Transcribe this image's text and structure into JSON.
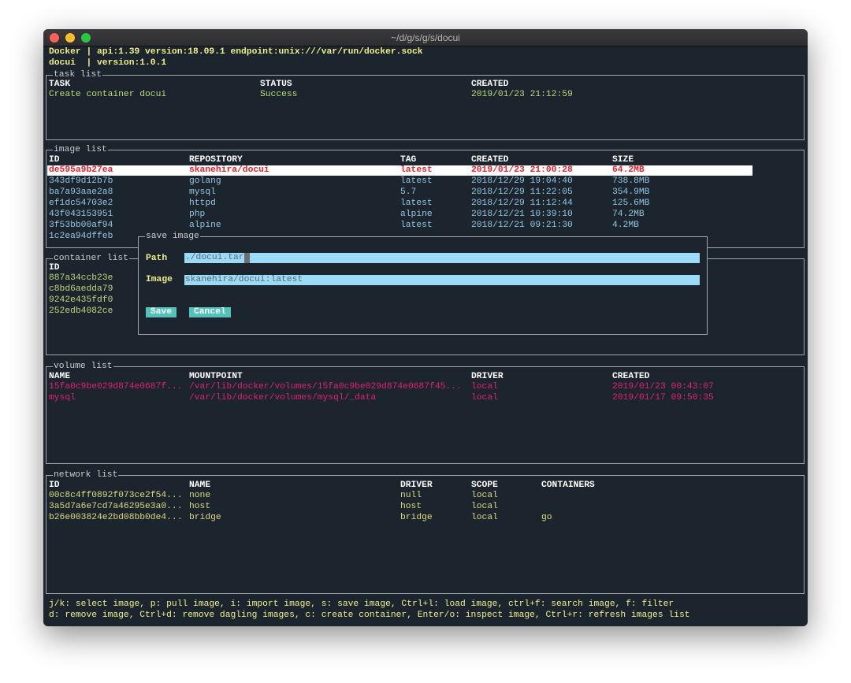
{
  "window": {
    "title": "~/d/g/s/g/s/docui"
  },
  "header": {
    "line1": "Docker | api:1.39 version:18.09.1 endpoint:unix:///var/run/docker.sock",
    "line2": "docui  | version:1.0.1"
  },
  "colors": {
    "task": "#b8dc7c",
    "image": "#92c6e4",
    "selected_text": "#e8202a",
    "container": "#bcd87a",
    "volume": "#e61e7c",
    "network": "#dcda7e",
    "header_yellow": "#efee8c"
  },
  "task_list": {
    "title": "task list",
    "columns": [
      "TASK",
      "STATUS",
      "CREATED"
    ],
    "rows": [
      [
        "Create container docui",
        "Success",
        "2019/01/23 21:12:59"
      ]
    ]
  },
  "image_list": {
    "title": "image list",
    "columns": [
      "ID",
      "REPOSITORY",
      "TAG",
      "CREATED",
      "SIZE"
    ],
    "selected_index": 0,
    "rows": [
      [
        "de595a9b27ea",
        "skanehira/docui",
        "latest",
        "2019/01/23 21:00:28",
        "64.2MB"
      ],
      [
        "343df9d12b7b",
        "golang",
        "latest",
        "2018/12/29 19:04:40",
        "738.8MB"
      ],
      [
        "ba7a93aae2a8",
        "mysql",
        "5.7",
        "2018/12/29 11:22:05",
        "354.9MB"
      ],
      [
        "ef1dc54703e2",
        "httpd",
        "latest",
        "2018/12/29 11:12:44",
        "125.6MB"
      ],
      [
        "43f043153951",
        "php",
        "alpine",
        "2018/12/21 10:39:10",
        "74.2MB"
      ],
      [
        "3f53bb00af94",
        "alpine",
        "latest",
        "2018/12/21 09:21:30",
        "4.2MB"
      ],
      [
        "1c2ea94dffeb",
        "",
        "",
        "",
        ""
      ]
    ]
  },
  "container_list": {
    "title": "container list",
    "columns": [
      "ID"
    ],
    "rows": [
      [
        "887a34ccb23e"
      ],
      [
        "c8bd6aedda79"
      ],
      [
        "9242e435fdf0"
      ],
      [
        "252edb4082ce"
      ]
    ]
  },
  "save_dialog": {
    "title": "save image",
    "path_label": "Path",
    "path_value": "./docui.tar",
    "image_label": "Image",
    "image_value": "skanehira/docui:latest",
    "save_label": "Save",
    "cancel_label": "Cancel"
  },
  "volume_list": {
    "title": "volume list",
    "columns": [
      "NAME",
      "MOUNTPOINT",
      "DRIVER",
      "CREATED"
    ],
    "rows": [
      [
        "15fa0c9be029d874e0687f...",
        "/var/lib/docker/volumes/15fa0c9be029d874e0687f45...",
        "local",
        "2019/01/23 00:43:07"
      ],
      [
        "mysql",
        "/var/lib/docker/volumes/mysql/_data",
        "local",
        "2019/01/17 09:50:35"
      ]
    ]
  },
  "network_list": {
    "title": "network list",
    "columns": [
      "ID",
      "NAME",
      "DRIVER",
      "SCOPE",
      "CONTAINERS"
    ],
    "rows": [
      [
        "00c8c4ff0892f073ce2f54...",
        "none",
        "null",
        "local",
        ""
      ],
      [
        "3a5d7a6e7cd7a46295e3a0...",
        "host",
        "host",
        "local",
        ""
      ],
      [
        "b26e003824e2bd08bb0de4...",
        "bridge",
        "bridge",
        "local",
        "go"
      ]
    ]
  },
  "footer": {
    "line1": "j/k: select image, p: pull image, i: import image, s: save image, Ctrl+l: load image, ctrl+f: search image, f: filter",
    "line2": "d: remove image, Ctrl+d: remove dagling images, c: create container, Enter/o: inspect image, Ctrl+r: refresh images list"
  }
}
